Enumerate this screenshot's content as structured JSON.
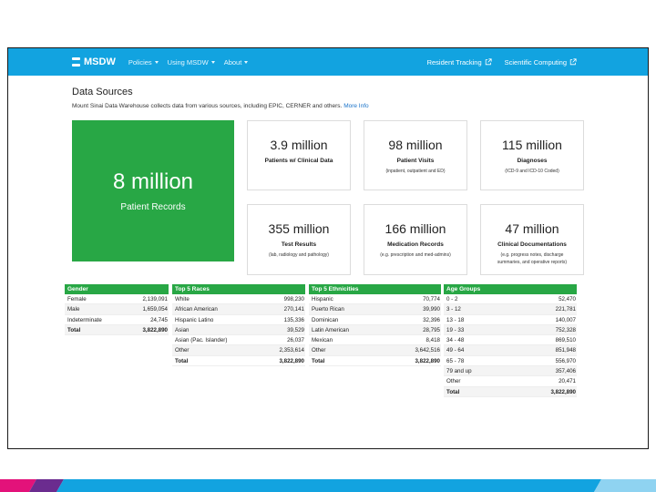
{
  "nav": {
    "brand": "MSDW",
    "items": [
      {
        "label": "Policies"
      },
      {
        "label": "Using MSDW"
      },
      {
        "label": "About"
      }
    ],
    "right": [
      {
        "label": "Resident Tracking"
      },
      {
        "label": "Scientific Computing"
      }
    ]
  },
  "page": {
    "title": "Data Sources",
    "intro": "Mount Sinai Data Warehouse collects data from various sources, including EPIC, CERNER and others.",
    "more_info": "More Info"
  },
  "hero": {
    "value": "8 million",
    "label": "Patient Records"
  },
  "stats": [
    {
      "value": "3.9 million",
      "label": "Patients w/ Clinical Data",
      "sub": ""
    },
    {
      "value": "98 million",
      "label": "Patient Visits",
      "sub": "(inpatient, outpatient and ED)"
    },
    {
      "value": "115 million",
      "label": "Diagnoses",
      "sub": "(ICD-9 and ICD-10 Coded)"
    },
    {
      "value": "355 million",
      "label": "Test Results",
      "sub": "(lab, radiology and pathology)"
    },
    {
      "value": "166 million",
      "label": "Medication Records",
      "sub": "(e.g. prescription and med-admins)"
    },
    {
      "value": "47 million",
      "label": "Clinical Documentations",
      "sub": "(e.g. progress notes, discharge summaries, and operative reports)"
    }
  ],
  "tables": {
    "gender": {
      "title": "Gender",
      "rows": [
        {
          "name": "Female",
          "value": "2,139,091"
        },
        {
          "name": "Male",
          "value": "1,659,054"
        },
        {
          "name": "Indeterminate",
          "value": "24,745"
        },
        {
          "name": "Total",
          "value": "3,822,890"
        }
      ]
    },
    "races": {
      "title": "Top 5 Races",
      "rows": [
        {
          "name": "White",
          "value": "998,230"
        },
        {
          "name": "African American",
          "value": "270,141"
        },
        {
          "name": "Hispanic Latino",
          "value": "135,336"
        },
        {
          "name": "Asian",
          "value": "39,529"
        },
        {
          "name": "Asian (Pac. Islander)",
          "value": "26,037"
        },
        {
          "name": "Other",
          "value": "2,353,614"
        },
        {
          "name": "Total",
          "value": "3,822,890"
        }
      ]
    },
    "ethnicities": {
      "title": "Top 5 Ethnicities",
      "rows": [
        {
          "name": "Hispanic",
          "value": "70,774"
        },
        {
          "name": "Puerto Rican",
          "value": "39,990"
        },
        {
          "name": "Dominican",
          "value": "32,396"
        },
        {
          "name": "Latin American",
          "value": "28,795"
        },
        {
          "name": "Mexican",
          "value": "8,418"
        },
        {
          "name": "Other",
          "value": "3,642,516"
        },
        {
          "name": "Total",
          "value": "3,822,890"
        }
      ]
    },
    "ages": {
      "title": "Age Groups",
      "rows": [
        {
          "name": "0 - 2",
          "value": "52,470"
        },
        {
          "name": "3 - 12",
          "value": "221,781"
        },
        {
          "name": "13 - 18",
          "value": "140,007"
        },
        {
          "name": "19 - 33",
          "value": "752,328"
        },
        {
          "name": "34 - 48",
          "value": "869,510"
        },
        {
          "name": "49 - 64",
          "value": "851,948"
        },
        {
          "name": "65 - 78",
          "value": "556,970"
        },
        {
          "name": "79 and up",
          "value": "357,406"
        },
        {
          "name": "Other",
          "value": "20,471"
        },
        {
          "name": "Total",
          "value": "3,822,890"
        }
      ]
    }
  },
  "colors": {
    "navbar": "#12a3e0",
    "accent_green": "#28a745",
    "link": "#1a73c9"
  }
}
